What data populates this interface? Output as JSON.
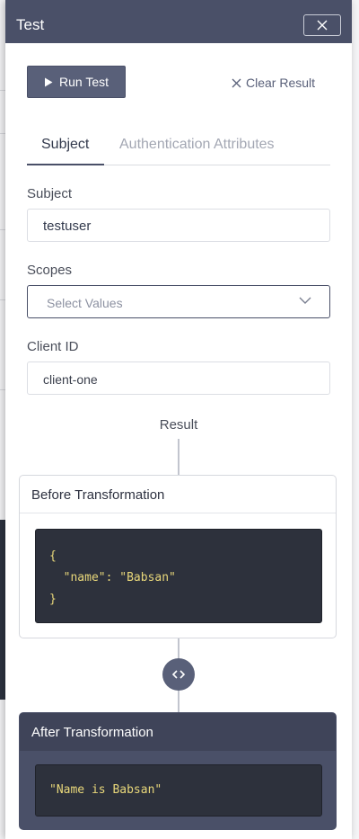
{
  "modal": {
    "title": "Test",
    "run_label": "Run Test",
    "clear_label": "Clear Result"
  },
  "tabs": [
    {
      "label": "Subject",
      "active": true
    },
    {
      "label": "Authentication Attributes",
      "active": false
    }
  ],
  "form": {
    "subject_label": "Subject",
    "subject_value": "testuser",
    "scopes_label": "Scopes",
    "scopes_placeholder": "Select Values",
    "client_label": "Client ID",
    "client_value": "client-one"
  },
  "result": {
    "label": "Result",
    "before_title": "Before Transformation",
    "before_code": [
      "{",
      "  \"name\": \"Babsan\"",
      "}"
    ],
    "after_title": "After Transformation",
    "after_code": "\"Name is Babsan\""
  },
  "colors": {
    "header_bg": "#4a5068",
    "button_bg": "#596079",
    "code_bg": "#2d313c",
    "code_text": "#e8d77a"
  }
}
